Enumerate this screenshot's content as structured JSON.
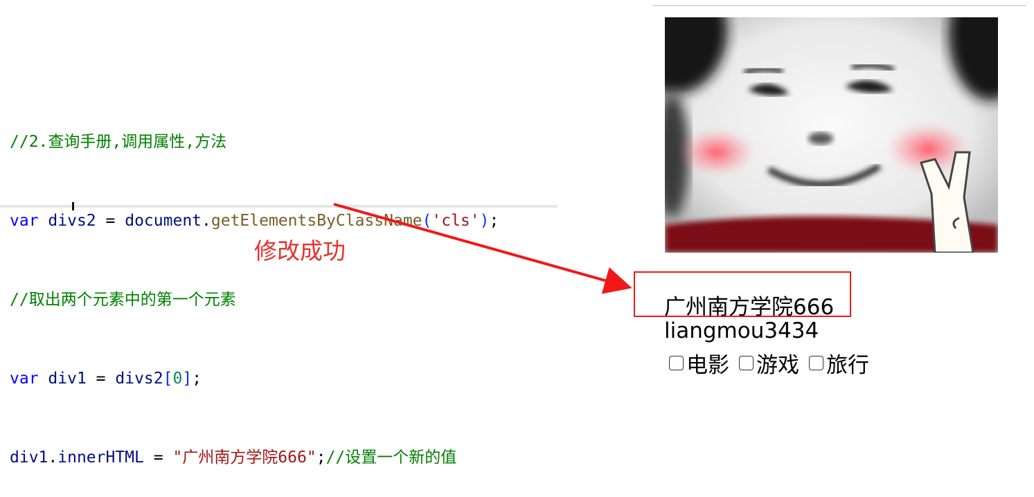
{
  "code_lines": [
    {
      "comment": "//2.查询手册,调用属性,方法"
    },
    {
      "kw": "var",
      "id": "divs2",
      "eq": "=",
      "obj": "document",
      "fn": "getElementsByClassName",
      "str": "'cls'",
      "end": ";"
    },
    {
      "comment": "//取出两个元素中的第一个元素"
    },
    {
      "kw": "var",
      "id": "div1",
      "eq": "=",
      "obj": "divs2",
      "idx": "0",
      "end": ";"
    },
    {
      "id": "div1",
      "prop": "innerHTML",
      "eq": "=",
      "str": "\"广州南方学院666\"",
      "end": ";",
      "comment": "//设置一个新的值"
    }
  ],
  "annotation": {
    "text": "修改成功",
    "color": "#e8302a"
  },
  "preview": {
    "meme_image": "blushing-panda-meme",
    "div1_text": "广州南方学院666",
    "div2_text": "liangmou3434",
    "hobbies": [
      {
        "label": "电影",
        "checked": false
      },
      {
        "label": "游戏",
        "checked": false
      },
      {
        "label": "旅行",
        "checked": false
      }
    ]
  }
}
